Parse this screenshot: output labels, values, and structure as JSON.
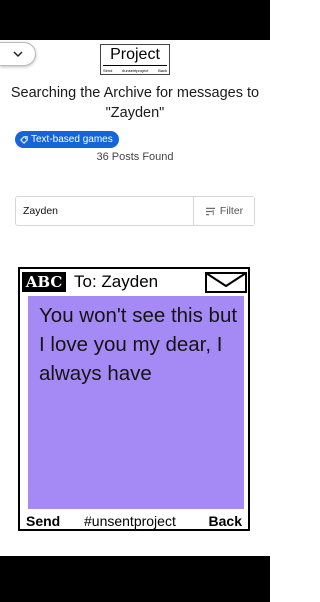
{
  "header": {
    "logo_title": "Project",
    "logo_links": [
      "Send",
      "#unsentproject",
      "Back"
    ],
    "collapse_icon": "chevron-down-icon"
  },
  "search_result": {
    "headline": "Searching the Archive for messages to \"Zayden\"",
    "tag_label": "Text-based games",
    "tag_icon": "tag-icon",
    "count_text": "36 Posts Found"
  },
  "search": {
    "value": "Zayden",
    "filter_label": "Filter",
    "filter_icon": "filter-sort-icon"
  },
  "post": {
    "badge": "ABC",
    "to_label": "To: Zayden",
    "envelope_icon": "envelope-icon",
    "message": "You won't see this but I love you my dear, I always have",
    "footer_send": "Send",
    "footer_hashtag": "#unsentproject",
    "footer_back": "Back",
    "message_color": "#a58af5"
  },
  "colors": {
    "accent": "#1565d8",
    "chrome": "#000000"
  }
}
